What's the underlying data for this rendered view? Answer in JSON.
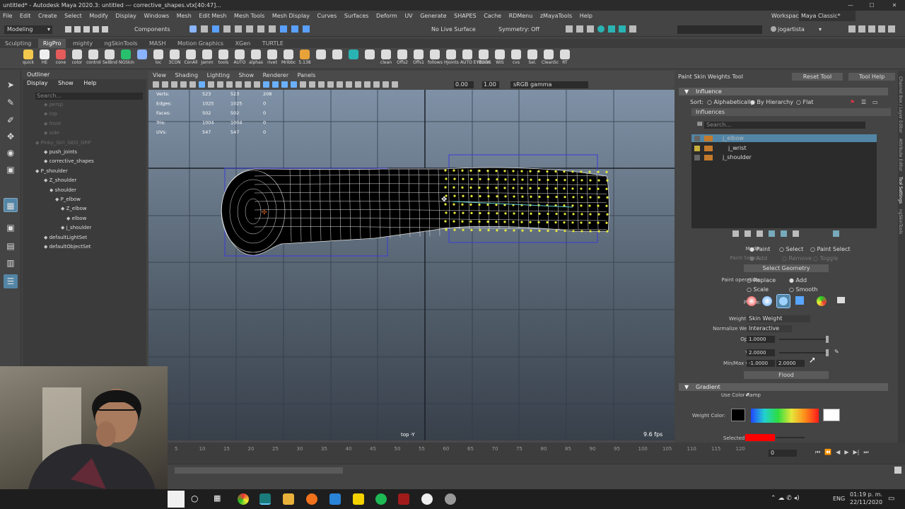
{
  "titlebar": {
    "title": "untitled* - Autodesk Maya 2020.3: untitled   ---   corrective_shapes.vtx[40:47]...",
    "minimize": "—",
    "maximize": "☐",
    "close": "✕"
  },
  "menubar": [
    "File",
    "Edit",
    "Create",
    "Select",
    "Modify",
    "Display",
    "Windows",
    "Mesh",
    "Edit Mesh",
    "Mesh Tools",
    "Mesh Display",
    "Curves",
    "Surfaces",
    "Deform",
    "UV",
    "Generate",
    "SHAPES",
    "Cache",
    "RDMenu",
    "zMayaTools",
    "Help"
  ],
  "workspace": {
    "label": "Workspace :",
    "value": "Maya Classic*"
  },
  "statusline": {
    "mode": "Modeling",
    "components": "Components",
    "live_surface": "No Live Surface",
    "symmetry": "Symmetry: Off",
    "user": "jogartista"
  },
  "shelf_tabs": [
    "Sculpting",
    "RigPro",
    "mighty",
    "ngSkinTools",
    "MASH",
    "Motion Graphics",
    "XGen",
    "TURTLE"
  ],
  "shelf_buttons": [
    "quick",
    "HE",
    "cone",
    "color",
    "control",
    "SelBnd",
    "NGSkin",
    "",
    "loc",
    "3CON",
    "ConAll",
    "Jamm",
    "tools",
    "AUTO",
    "alphas",
    "rivet",
    "Mribbc",
    "5.138",
    "",
    "",
    "",
    "",
    "clean",
    "Offs2",
    "Offs1",
    "follows",
    "HJoints",
    "AUTO EYELIDS",
    "ribbon",
    "WIS",
    "cvs",
    "Sel.",
    "CleanSc",
    "RT"
  ],
  "outliner": {
    "title": "Outliner",
    "menu": [
      "Display",
      "Show",
      "Help"
    ],
    "search_placeholder": "Search...",
    "items": [
      {
        "label": "persp",
        "dim": true
      },
      {
        "label": "top",
        "dim": true
      },
      {
        "label": "front",
        "dim": true
      },
      {
        "label": "side",
        "dim": true
      },
      {
        "label": "Pinky_Girl_GEO_GRP",
        "dim": true
      },
      {
        "label": "push_joints",
        "dim": false
      },
      {
        "label": "corrective_shapes",
        "dim": false
      },
      {
        "label": "P_shoulder",
        "dim": false
      },
      {
        "label": "Z_shoulder",
        "dim": false
      },
      {
        "label": "shoulder",
        "dim": false
      },
      {
        "label": "P_elbow",
        "dim": false
      },
      {
        "label": "Z_elbow",
        "dim": false
      },
      {
        "label": "elbow",
        "dim": false
      },
      {
        "label": "j_shoulder",
        "dim": false
      },
      {
        "label": "defaultLightSet",
        "dim": false
      },
      {
        "label": "defaultObjectSet",
        "dim": false
      }
    ]
  },
  "viewport": {
    "menu": [
      "View",
      "Shading",
      "Lighting",
      "Show",
      "Renderer",
      "Panels"
    ],
    "field1": "0.00",
    "field2": "1.00",
    "color_space": "sRGB gamma",
    "camera_label": "top -Y",
    "fps": "9.6 fps",
    "hud": [
      {
        "label": "Verts:",
        "v1": "523",
        "v2": "523",
        "v3": "208"
      },
      {
        "label": "Edges:",
        "v1": "1025",
        "v2": "1025",
        "v3": "0"
      },
      {
        "label": "Faces:",
        "v1": "502",
        "v2": "502",
        "v3": "0"
      },
      {
        "label": "Tris:",
        "v1": "1004",
        "v2": "1004",
        "v3": "0"
      },
      {
        "label": "UVs:",
        "v1": "547",
        "v2": "547",
        "v3": "0"
      }
    ]
  },
  "tool": {
    "title": "Paint Skin Weights Tool",
    "reset": "Reset Tool",
    "help": "Tool Help",
    "influence_header": "Influence",
    "sort_label": "Sort:",
    "sort_options": [
      "Alphabetically",
      "By Hierarchy",
      "Flat"
    ],
    "influences_label": "Influences",
    "search_placeholder": "Search...",
    "influences": [
      "j_elbow",
      "j_wrist",
      "j_shoulder"
    ],
    "mode_label": "Mode:",
    "mode_options": [
      "Paint",
      "Select",
      "Paint Select"
    ],
    "paint_select_label": "Paint Select:",
    "paint_select_options": [
      "Add",
      "Remove",
      "Toggle"
    ],
    "select_geometry": "Select Geometry",
    "paint_operation_label": "Paint operation:",
    "paint_ops": [
      "Replace",
      "Add",
      "Scale",
      "Smooth"
    ],
    "profile_label": "Profile:",
    "weight_type_label": "Weight Type:",
    "weight_type": "Skin Weight",
    "normalize_label": "Normalize Weights:",
    "normalize": "Interactive",
    "opacity_label": "Opacity:",
    "opacity": "1.0000",
    "value_label": "Value:",
    "value": "2.0000",
    "minmax_label": "Min/Max value:",
    "min": "-1.0000",
    "max": "2.0000",
    "flood": "Flood",
    "gradient_header": "Gradient",
    "use_color_ramp": "Use Color Ramp",
    "weight_color_label": "Weight Color:",
    "selected_color_label": "Selected Color:",
    "selected_color": "#ff0000"
  },
  "side_tabs": [
    "Channel Box / Layer Editor",
    "Attribute Editor",
    "Tool Settings",
    "ngSkinTools"
  ],
  "timeline": {
    "ticks": [
      "5",
      "10",
      "15",
      "20",
      "25",
      "30",
      "35",
      "40",
      "45",
      "50",
      "55",
      "60",
      "65",
      "70",
      "75",
      "80",
      "85",
      "90",
      "95",
      "100",
      "105",
      "110",
      "115",
      "120"
    ],
    "current": "0"
  },
  "taskbar": {
    "time": "01:19 p. m.",
    "date": "22/11/2020",
    "lang": "ENG"
  },
  "colors": {
    "selected_verts": "#e8e83a",
    "mesh_wire": "#ffffff",
    "bbox": "#3b3bd6",
    "accent": "#5285a6"
  }
}
